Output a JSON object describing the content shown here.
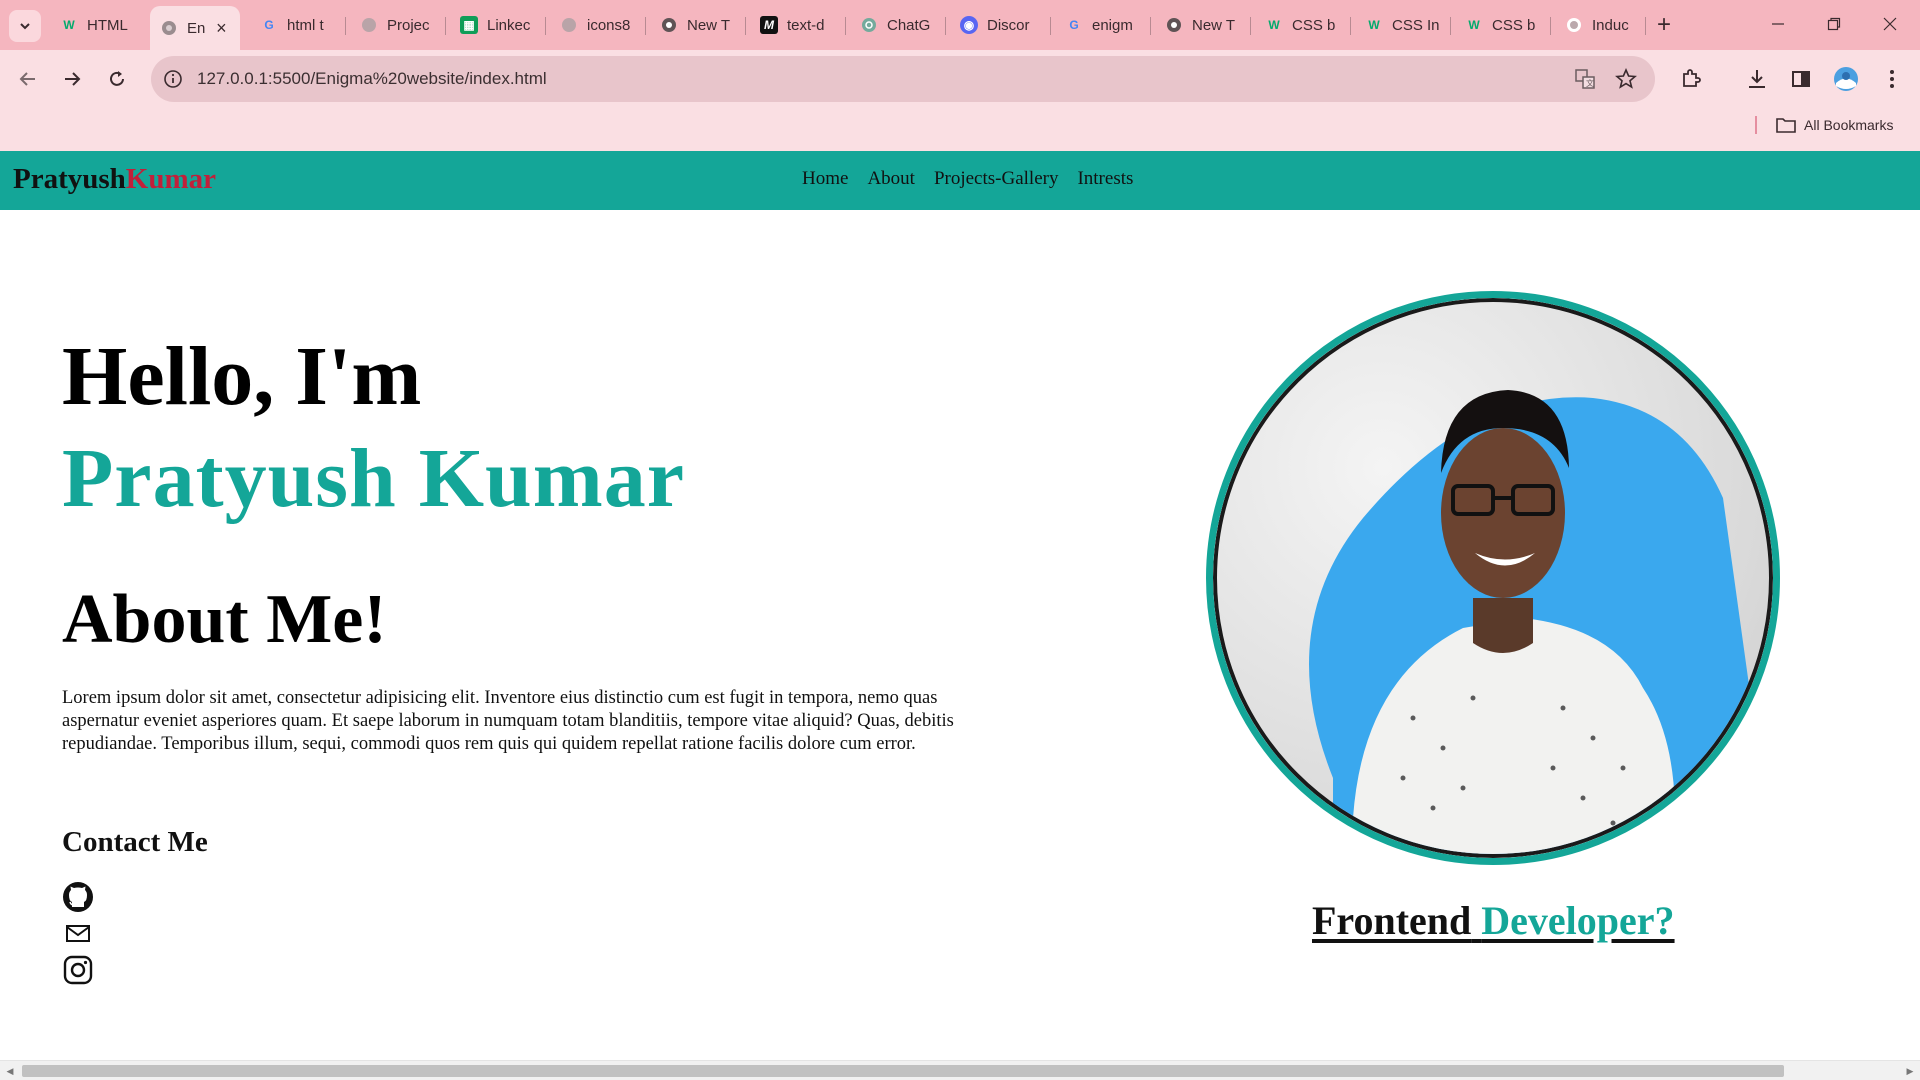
{
  "browser": {
    "tabs": [
      {
        "label": "HTML",
        "icon": "w3schools-icon",
        "active": false
      },
      {
        "label": "En",
        "icon": "globe-icon",
        "active": true
      },
      {
        "label": "html t",
        "icon": "google-icon",
        "active": false
      },
      {
        "label": "Projec",
        "icon": "globe-icon",
        "active": false
      },
      {
        "label": "Linkec",
        "icon": "sheet-icon",
        "active": false
      },
      {
        "label": "icons8",
        "icon": "globe-icon",
        "active": false
      },
      {
        "label": "New T",
        "icon": "chrome-icon",
        "active": false
      },
      {
        "label": "text-d",
        "icon": "m-icon",
        "active": false
      },
      {
        "label": "ChatG",
        "icon": "chatgpt-icon",
        "active": false
      },
      {
        "label": "Discor",
        "icon": "discord-icon",
        "active": false
      },
      {
        "label": "enigm",
        "icon": "google-icon",
        "active": false
      },
      {
        "label": "New T",
        "icon": "chrome-icon",
        "active": false
      },
      {
        "label": "CSS b",
        "icon": "w3schools-icon",
        "active": false
      },
      {
        "label": "CSS In",
        "icon": "w3schools-icon",
        "active": false
      },
      {
        "label": "CSS b",
        "icon": "w3schools-icon",
        "active": false
      },
      {
        "label": "Induc",
        "icon": "github-icon",
        "active": false
      }
    ],
    "url": "127.0.0.1:5500/Enigma%20website/index.html",
    "bookmarks_label": "All Bookmarks",
    "colors": {
      "tabstrip": "#f5b6bf",
      "toolbar": "#fadfe3",
      "omnibox": "#e8c5cb"
    }
  },
  "site": {
    "logo_first": "Pratyush",
    "logo_second": "Kumar",
    "nav": [
      "Home",
      "About",
      "Projects-Gallery",
      "Intrests"
    ],
    "hello": "Hello, I'm",
    "name": "Pratyush Kumar",
    "about_heading": "About Me!",
    "about_text": "Lorem ipsum dolor sit amet, consectetur adipisicing elit. Inventore eius distinctio cum est fugit in tempora, nemo quas aspernatur eveniet asperiores quam. Et saepe laborum in numquam totam blanditiis, tempore vitae aliquid? Quas, debitis repudiandae. Temporibus illum, sequi, commodi quos rem quis qui quidem repellat ratione facilis dolore cum error.",
    "contact_heading": "Contact Me",
    "social_icons": [
      "github-icon",
      "mail-icon",
      "instagram-icon"
    ],
    "tagline_first": "Frontend",
    "tagline_second": "Developer?",
    "colors": {
      "accent": "#14a698",
      "logo_accent": "#c21f3a",
      "portrait_blob": "#3aa8ee"
    }
  }
}
